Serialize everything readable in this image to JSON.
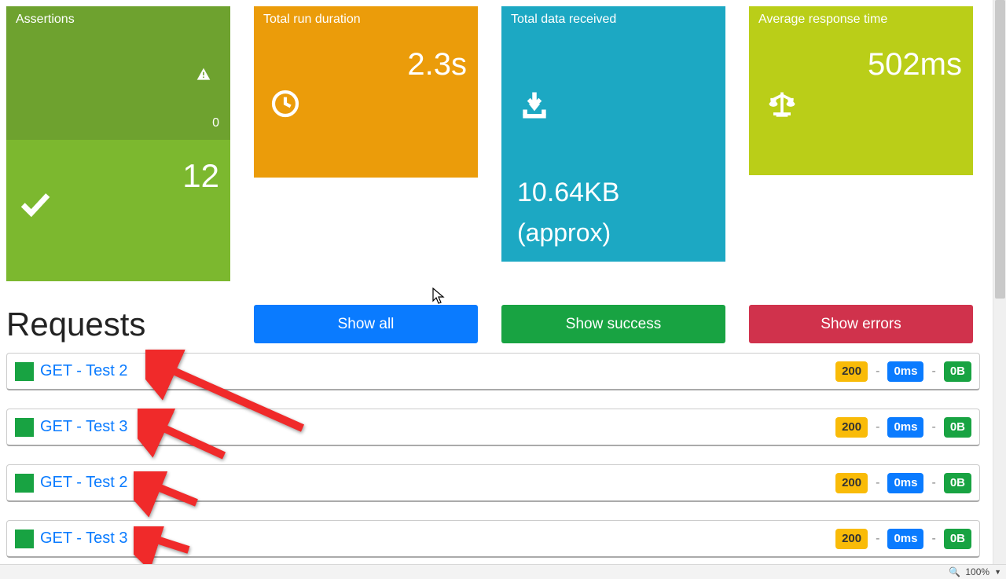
{
  "cards": {
    "assertions": {
      "title": "Assertions",
      "warn_count": "0",
      "pass_count": "12"
    },
    "duration": {
      "title": "Total run duration",
      "value": "2.3s"
    },
    "data": {
      "title": "Total data received",
      "value": "10.64KB",
      "approx": "(approx)"
    },
    "avg": {
      "title": "Average response time",
      "value": "502ms"
    }
  },
  "requests": {
    "heading": "Requests",
    "buttons": {
      "all": "Show all",
      "success": "Show success",
      "errors": "Show errors"
    },
    "rows": [
      {
        "name": "GET - Test 2",
        "status": "200",
        "time": "0ms",
        "size": "0B"
      },
      {
        "name": "GET - Test 3",
        "status": "200",
        "time": "0ms",
        "size": "0B"
      },
      {
        "name": "GET - Test 2",
        "status": "200",
        "time": "0ms",
        "size": "0B"
      },
      {
        "name": "GET - Test 3",
        "status": "200",
        "time": "0ms",
        "size": "0B"
      }
    ],
    "sep": "-"
  },
  "statusbar": {
    "zoom": "100%"
  }
}
